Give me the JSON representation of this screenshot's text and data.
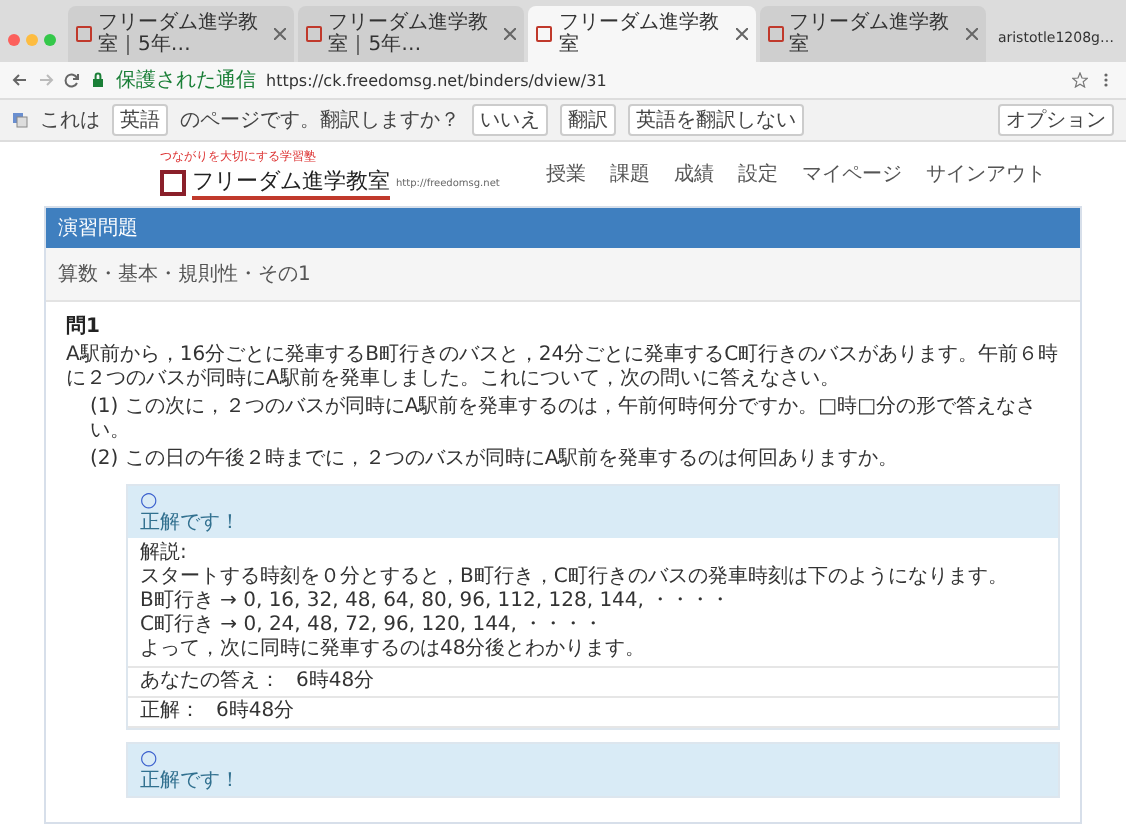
{
  "browser": {
    "tabs": [
      {
        "label": "フリーダム進学教室｜5年…",
        "selected": false
      },
      {
        "label": "フリーダム進学教室｜5年…",
        "selected": false
      },
      {
        "label": "フリーダム進学教室",
        "selected": true
      },
      {
        "label": "フリーダム進学教室",
        "selected": false
      }
    ],
    "user": "aristotle1208g…",
    "secure_label": "保護された通信",
    "address": "https://ck.freedomsg.net/binders/dview/31",
    "translate_bar": {
      "prefix": "これは",
      "language": "英語",
      "question": "のページです。翻訳しますか？",
      "buttons": [
        "いいえ",
        "翻訳",
        "英語を翻訳しない"
      ],
      "options": "オプション"
    }
  },
  "site": {
    "tagline": "つながりを大切にする学習塾",
    "logo_name": "フリーダム進学教室",
    "logo_url": "http://freedomsg.net",
    "nav": [
      "授業",
      "課題",
      "成績",
      "設定",
      "マイページ",
      "サインアウト"
    ]
  },
  "panel": {
    "title": "演習問題",
    "subtitle": "算数・基本・規則性・その1",
    "question": {
      "number": "問1",
      "text": "A駅前から，16分ごとに発車するB町行きのバスと，24分ごとに発車するC町行きのバスがあります。午前６時に２つのバスが同時にA駅前を発車しました。これについて，次の問いに答えなさい。",
      "parts": [
        "(1) この次に，２つのバスが同時にA駅前を発車するのは，午前何時何分ですか。□時□分の形で答えなさい。",
        "(2) この日の午後２時までに，２つのバスが同時にA駅前を発車するのは何回ありますか。"
      ]
    },
    "results": [
      {
        "mark": "○",
        "verdict": "正解です！",
        "explanation_label": "解説:",
        "explanation": [
          "スタートする時刻を０分とすると，B町行き，C町行きのバスの発車時刻は下のようになります。",
          "B町行き → 0, 16, 32, 48, 64, 80, 96, 112, 128, 144, ・・・・",
          "C町行き → 0, 24, 48, 72, 96, 120, 144, ・・・・",
          "よって，次に同時に発車するのは48分後とわかります。"
        ],
        "your_answer_label": "あなたの答え：",
        "your_answer": "6時48分",
        "correct_label": "正解：",
        "correct": "6時48分"
      },
      {
        "mark": "○",
        "verdict": "正解です！"
      }
    ]
  }
}
